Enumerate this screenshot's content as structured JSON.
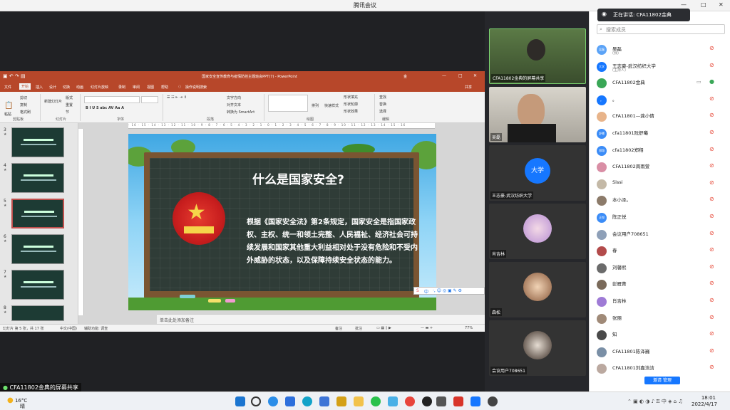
{
  "window": {
    "title": "腾讯会议",
    "minimize": "—",
    "maximize": "□",
    "close": "✕"
  },
  "ppt": {
    "title": "国家安全宣传教育与疫情防控主题班会PPT(7) - PowerPoint",
    "account": "金",
    "menu": [
      "文件",
      "开始",
      "插入",
      "设计",
      "切换",
      "动画",
      "幻灯片放映",
      "录制",
      "审阅",
      "视图",
      "帮助",
      "操作说明搜索",
      "共享"
    ],
    "ribbon_groups": [
      "剪贴板",
      "幻灯片",
      "字体",
      "段落",
      "绘图",
      "编辑"
    ],
    "ribbon_labels": [
      "剪切",
      "复制",
      "格式刷",
      "粘贴",
      "新建幻灯片",
      "版式",
      "重置",
      "节",
      "文字方向",
      "对齐文本",
      "转换为 SmartArt",
      "排列",
      "快速样式",
      "形状填充",
      "形状轮廓",
      "形状效果",
      "查找",
      "替换",
      "选择"
    ],
    "thumbnail_numbers": [
      "3",
      "4",
      "5",
      "6",
      "7",
      "8"
    ],
    "slide": {
      "title": "什么是国家安全?",
      "body": "根据《国家安全法》第2条规定，国家安全是指国家政权、主权、统一和领土完整、人民福祉、经济社会可持续发展和国家其他重大利益相对处于没有危险和不受内外威胁的状态，以及保障持续安全状态的能力。"
    },
    "notes_placeholder": "单击此处添加备注",
    "status": {
      "slide": "幻灯片 第 5 张，共 17 张",
      "lang": "中文(中国)",
      "accessibility": "辅助功能: 调查",
      "notes": "备注",
      "comments": "批注",
      "zoom": "77%"
    },
    "ime": "中"
  },
  "share_label": "CFA11802金典的屏幕共享",
  "speaking": "正在讲话: CFA11802金典",
  "videos": [
    {
      "name": "CFA11802金典的屏幕共享"
    },
    {
      "name": "吴磊"
    },
    {
      "name": "王志豪-武汉纺织大学",
      "avatar": "大学"
    },
    {
      "name": "肖吉林"
    },
    {
      "name": "森松"
    },
    {
      "name": "会议用户708651"
    }
  ],
  "participants_panel": {
    "search_placeholder": "搜索成员",
    "participants": [
      {
        "name": "吴磊",
        "sub": "(我)",
        "avatar": "吴磊"
      },
      {
        "name": "王志豪-武汉纺织大学",
        "sub": "(主持人)",
        "avatar": "大学"
      },
      {
        "name": "CFA11802金典",
        "sub": "",
        "avatar": ""
      },
      {
        "name": "。",
        "sub": "",
        "avatar": "。"
      },
      {
        "name": "CFA11801—龚小倩",
        "sub": "",
        "avatar": ""
      },
      {
        "name": "cfa11801阮舒曦",
        "sub": "",
        "avatar": "舒曦"
      },
      {
        "name": "cfa11802郑翔",
        "sub": "",
        "avatar": "郑翔"
      },
      {
        "name": "CFA11802周雨萱",
        "sub": "",
        "avatar": ""
      },
      {
        "name": "Sissi",
        "sub": "",
        "avatar": ""
      },
      {
        "name": "本小泽。",
        "sub": "",
        "avatar": ""
      },
      {
        "name": "陈正悦",
        "sub": "",
        "avatar": "正悦"
      },
      {
        "name": "会议用户708651",
        "sub": "",
        "avatar": ""
      },
      {
        "name": "春",
        "sub": "",
        "avatar": ""
      },
      {
        "name": "刘馨熙",
        "sub": "",
        "avatar": ""
      },
      {
        "name": "彭雁菁",
        "sub": "",
        "avatar": ""
      },
      {
        "name": "肖吉林",
        "sub": "",
        "avatar": ""
      },
      {
        "name": "张丽",
        "sub": "",
        "avatar": ""
      },
      {
        "name": "知",
        "sub": "",
        "avatar": ""
      },
      {
        "name": "CFA11801陈泽巍",
        "sub": "",
        "avatar": ""
      },
      {
        "name": "CFA11801刘嘉浩洁",
        "sub": "",
        "avatar": ""
      }
    ],
    "invite_button": "邀请 管理"
  },
  "taskbar": {
    "temp": "16°C",
    "weather": "晴朗",
    "time": "18:01",
    "date": "2022/4/17"
  },
  "colors": {
    "ppt_red": "#b7472a",
    "meeting_blue": "#1677ff",
    "mic_muted": "#e74c3c"
  }
}
